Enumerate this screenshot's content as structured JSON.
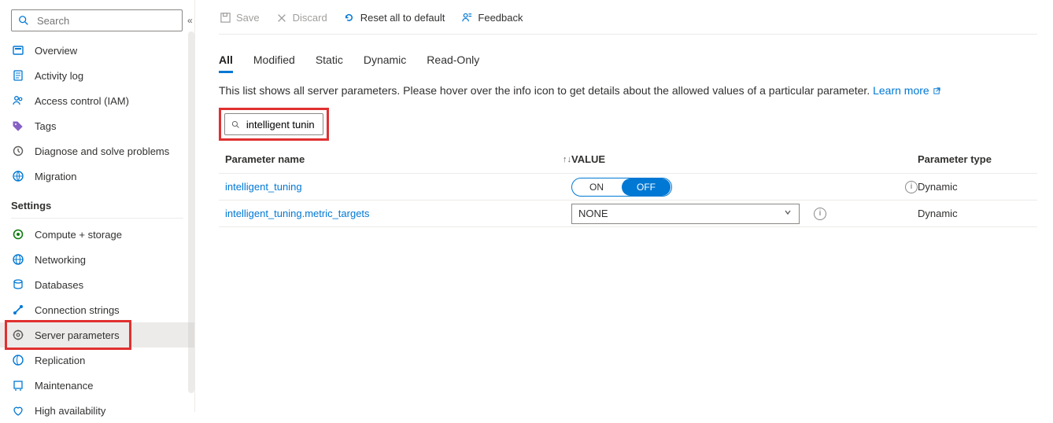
{
  "sidebar": {
    "search_placeholder": "Search",
    "items_top": [
      {
        "icon": "overview",
        "label": "Overview"
      },
      {
        "icon": "activity",
        "label": "Activity log"
      },
      {
        "icon": "iam",
        "label": "Access control (IAM)"
      },
      {
        "icon": "tags",
        "label": "Tags"
      },
      {
        "icon": "diagnose",
        "label": "Diagnose and solve problems"
      },
      {
        "icon": "migration",
        "label": "Migration"
      }
    ],
    "settings_header": "Settings",
    "items_settings": [
      {
        "icon": "compute",
        "label": "Compute + storage"
      },
      {
        "icon": "network",
        "label": "Networking"
      },
      {
        "icon": "databases",
        "label": "Databases"
      },
      {
        "icon": "conn",
        "label": "Connection strings"
      },
      {
        "icon": "params",
        "label": "Server parameters",
        "active": true,
        "highlight": true
      },
      {
        "icon": "repl",
        "label": "Replication"
      },
      {
        "icon": "maint",
        "label": "Maintenance"
      },
      {
        "icon": "ha",
        "label": "High availability"
      }
    ]
  },
  "toolbar": {
    "save": "Save",
    "discard": "Discard",
    "reset": "Reset all to default",
    "feedback": "Feedback"
  },
  "tabs": [
    "All",
    "Modified",
    "Static",
    "Dynamic",
    "Read-Only"
  ],
  "active_tab": "All",
  "description": "This list shows all server parameters. Please hover over the info icon to get details about the allowed values of a particular parameter.",
  "learn_more": "Learn more",
  "filter_value": "intelligent tuning",
  "columns": {
    "name": "Parameter name",
    "value": "VALUE",
    "type": "Parameter type"
  },
  "rows": [
    {
      "name": "intelligent_tuning",
      "value_type": "toggle",
      "on": "ON",
      "off": "OFF",
      "type": "Dynamic"
    },
    {
      "name": "intelligent_tuning.metric_targets",
      "value_type": "select",
      "value": "NONE",
      "type": "Dynamic"
    }
  ]
}
